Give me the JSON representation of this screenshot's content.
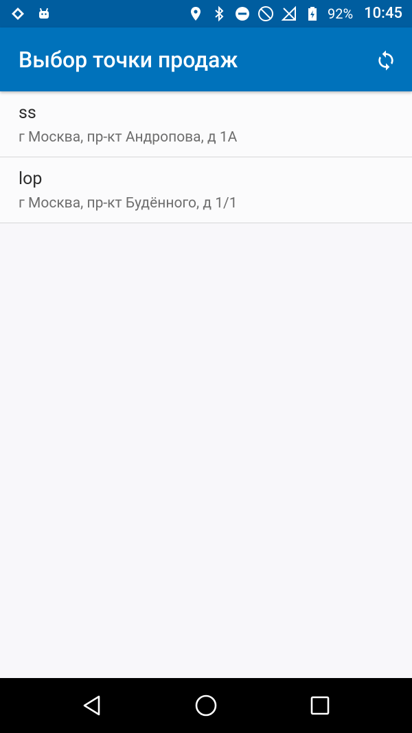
{
  "status_bar": {
    "battery_percent": "92%",
    "time": "10:45",
    "icons": [
      "network-icon",
      "android-icon",
      "location-icon",
      "bluetooth-icon",
      "do-not-disturb-icon",
      "wifi-icon",
      "no-signal-icon",
      "battery-icon"
    ]
  },
  "app_bar": {
    "title": "Выбор точки продаж",
    "action_icon": "refresh-icon"
  },
  "points_of_sale": [
    {
      "name": "ss",
      "address": "г Москва, пр-кт Андропова, д 1А"
    },
    {
      "name": "lop",
      "address": "г Москва, пр-кт Будённого, д 1/1"
    }
  ],
  "navigation": {
    "buttons": [
      "back-icon",
      "home-icon",
      "recents-icon"
    ]
  },
  "colors": {
    "status_bar": "#005d9f",
    "app_bar": "#0072bb",
    "background": "#f8f7fa"
  }
}
